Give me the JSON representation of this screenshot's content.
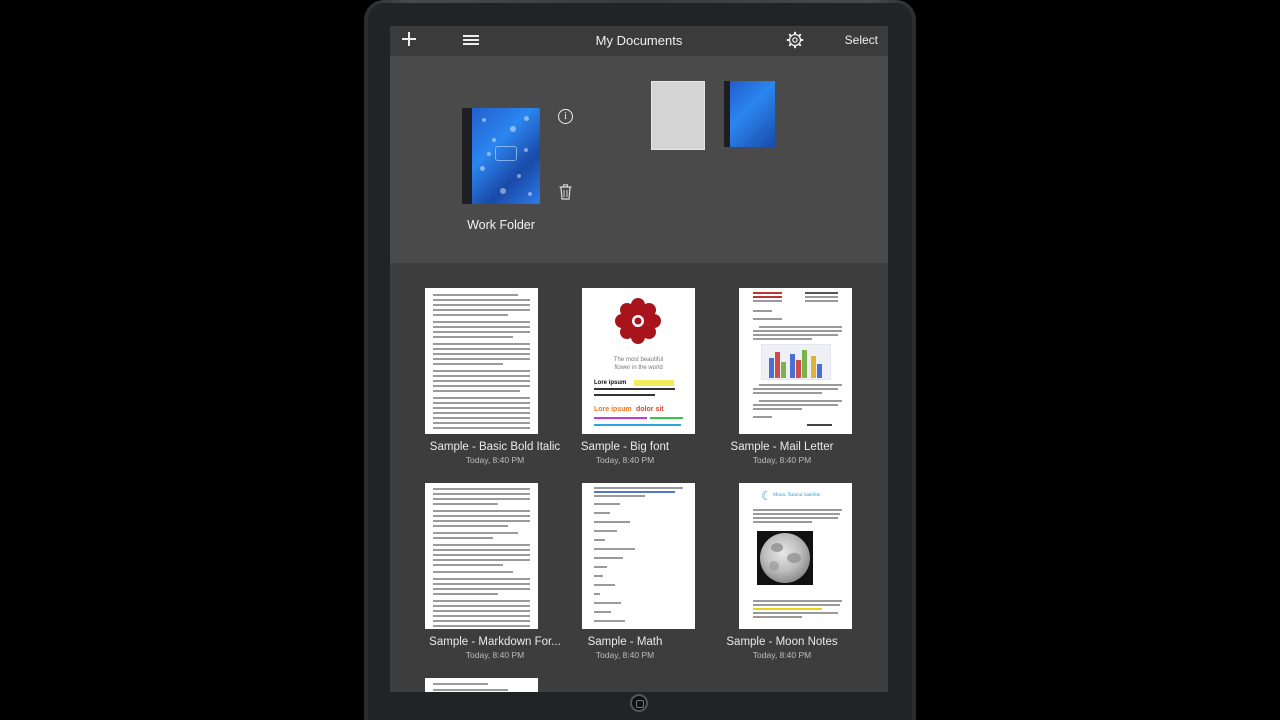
{
  "navbar": {
    "title": "My Documents",
    "select_label": "Select",
    "icons": [
      "plus-icon",
      "list-icon",
      "gear-icon"
    ]
  },
  "folder": {
    "name": "Work Folder",
    "icons": [
      "info-icon",
      "trash-icon"
    ],
    "cover_color": "#2b86f0"
  },
  "documents": [
    {
      "name": "Sample - Basic Bold Italic",
      "date": "Today, 8:40 PM"
    },
    {
      "name": "Sample - Big font",
      "date": "Today, 8:40 PM",
      "thumb_text": [
        "The most beautiful",
        "flower in the world",
        "Lore ipsum",
        "dolor sit"
      ]
    },
    {
      "name": "Sample - Mail Letter",
      "date": "Today, 8:40 PM"
    },
    {
      "name": "Sample - Markdown For...",
      "date": "Today, 8:40 PM"
    },
    {
      "name": "Sample - Math",
      "date": "Today, 8:40 PM"
    },
    {
      "name": "Sample - Moon Notes",
      "date": "Today, 8:40 PM",
      "thumb_text": [
        "Moon: Natural Satellite"
      ]
    }
  ],
  "colors": {
    "navbar_bg": "#3b3b3b",
    "folder_panel_bg": "#4a4a4a",
    "docs_bg": "#3d3d3d",
    "flower": "#a8141c"
  }
}
